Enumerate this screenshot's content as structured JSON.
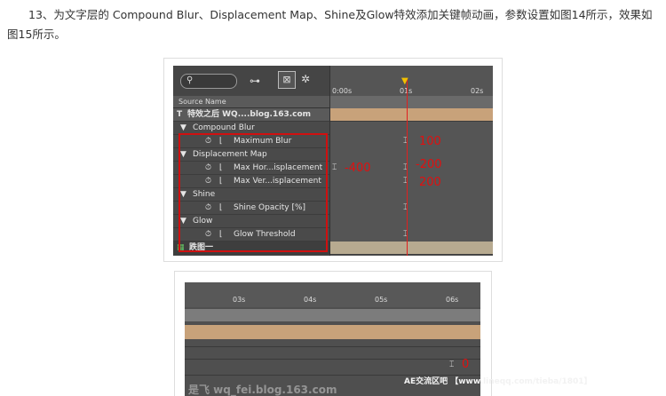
{
  "paragraph": "13、为文字层的 Compound Blur、Displacement Map、Shine及Glow特效添加关键帧动画，参数设置如图14所示，效果如图15所示。",
  "fig1": {
    "column_header": "Source Name",
    "ruler": [
      "0:00s",
      "01s",
      "02s"
    ],
    "layer_name": "特效之后 WQ....blog.163.com",
    "layer_index": "T",
    "bottom_layer": "跌图一",
    "effects": [
      {
        "name": "Compound Blur",
        "props": [
          "Maximum Blur"
        ]
      },
      {
        "name": "Displacement Map",
        "props": [
          "Max Hor...isplacement",
          "Max Ver...isplacement"
        ]
      },
      {
        "name": "Shine",
        "props": [
          "Shine Opacity [%]"
        ]
      },
      {
        "name": "Glow",
        "props": [
          "Glow Threshold"
        ]
      }
    ],
    "annotations": {
      "max_blur": "100",
      "hor_left": "-400",
      "hor_right": "-200",
      "ver": "200"
    }
  },
  "fig2": {
    "ruler": [
      "03s",
      "04s",
      "05s",
      "06s"
    ],
    "annotation": "0",
    "watermark_left": "是飞 wq_fei.blog.163.com",
    "watermark_right": "AE交流区吧 【www.lineqq.com/tieba/1801】"
  }
}
